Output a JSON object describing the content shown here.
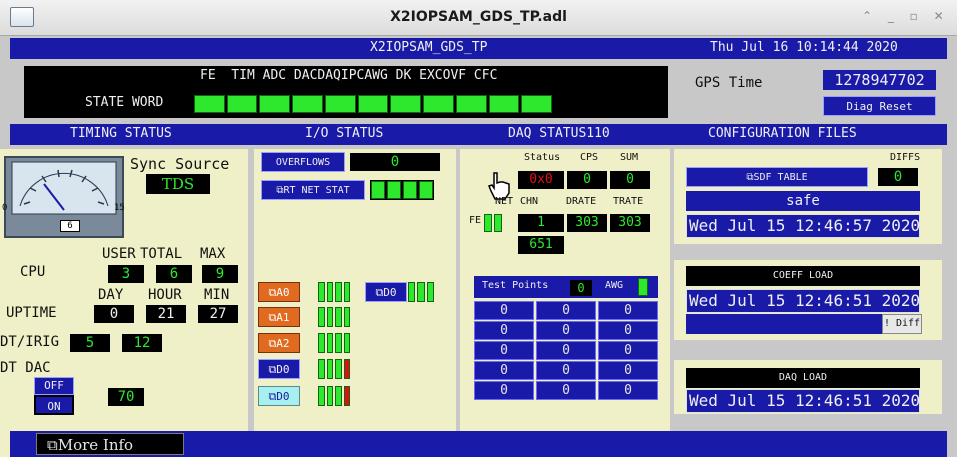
{
  "window": {
    "title": "X2IOPSAM_GDS_TP.adl",
    "controls": "⌃ _ ▫ ✕"
  },
  "header": {
    "model": "X2IOPSAM_GDS_TP",
    "datetime": "Thu Jul 16 10:14:44 2020"
  },
  "state_word": {
    "bit_names": "FE  TIM ADC DACDAQIPCAWG DK EXCOVF CFC",
    "label": "STATE WORD",
    "gps_label": "GPS Time",
    "gps_value": "1278947702",
    "diag_reset": "Diag Reset"
  },
  "sections": {
    "timing": "TIMING STATUS",
    "io": "I/O STATUS",
    "daq": "DAQ STATUS110",
    "config": "CONFIGURATION FILES"
  },
  "timing": {
    "sync_label": "Sync Source",
    "sync_value": "TDS",
    "gauge_min": "0",
    "gauge_max": "15",
    "gauge_value": "6",
    "cpu_headers": [
      "USER",
      "TOTAL",
      "MAX"
    ],
    "cpu_label": "CPU",
    "cpu_values": [
      "3",
      "6",
      "9"
    ],
    "uptime_headers": [
      "DAY",
      "HOUR",
      "MIN"
    ],
    "uptime_label": "UPTIME",
    "uptime_values": [
      "0",
      "21",
      "27"
    ],
    "dtirig_label": "DT/IRIG",
    "dtirig_values": [
      "5",
      "12"
    ],
    "dtdac_label": "DT DAC",
    "dtdac_off": "OFF",
    "dtdac_on": "ON",
    "dtdac_value": "70"
  },
  "io": {
    "overflows_label": "OVERFLOWS",
    "overflows_value": "0",
    "rtnet_label": "RT NET STAT",
    "adc": [
      "A0",
      "A1",
      "A2"
    ],
    "dac_d0": "D0",
    "d0a": "D0",
    "d0b": "D0"
  },
  "daq": {
    "status_hdr": "Status",
    "cps_hdr": "CPS",
    "sum_hdr": "SUM",
    "status_value": "0x0",
    "cps_value": "0",
    "sum_value": "0",
    "net_hdr": "NET",
    "chn_hdr": "CHN",
    "drate_hdr": "DRATE",
    "trate_hdr": "TRATE",
    "fe_label": "FE",
    "chn_value": "1",
    "drate_value": "303",
    "trate_value": "303",
    "total_value": "651",
    "tp_label": "Test Points",
    "tp_value": "0",
    "awg_label": "AWG",
    "tp_grid": [
      [
        "0",
        "0",
        "0"
      ],
      [
        "0",
        "0",
        "0"
      ],
      [
        "0",
        "0",
        "0"
      ],
      [
        "0",
        "0",
        "0"
      ],
      [
        "0",
        "0",
        "0"
      ]
    ]
  },
  "config": {
    "diffs_label": "DIFFS",
    "sdf_label": "SDF TABLE",
    "sdf_diffs": "0",
    "sdf_status": "safe",
    "sdf_time": "Wed Jul 15 12:46:57 2020",
    "coeff_label": "COEFF LOAD",
    "coeff_time": "Wed Jul 15 12:46:51 2020",
    "diff_btn": "! Diff",
    "daq_label": "DAQ LOAD",
    "daq_time": "Wed Jul 15 12:46:51 2020"
  },
  "footer": {
    "more_info": "More Info"
  }
}
